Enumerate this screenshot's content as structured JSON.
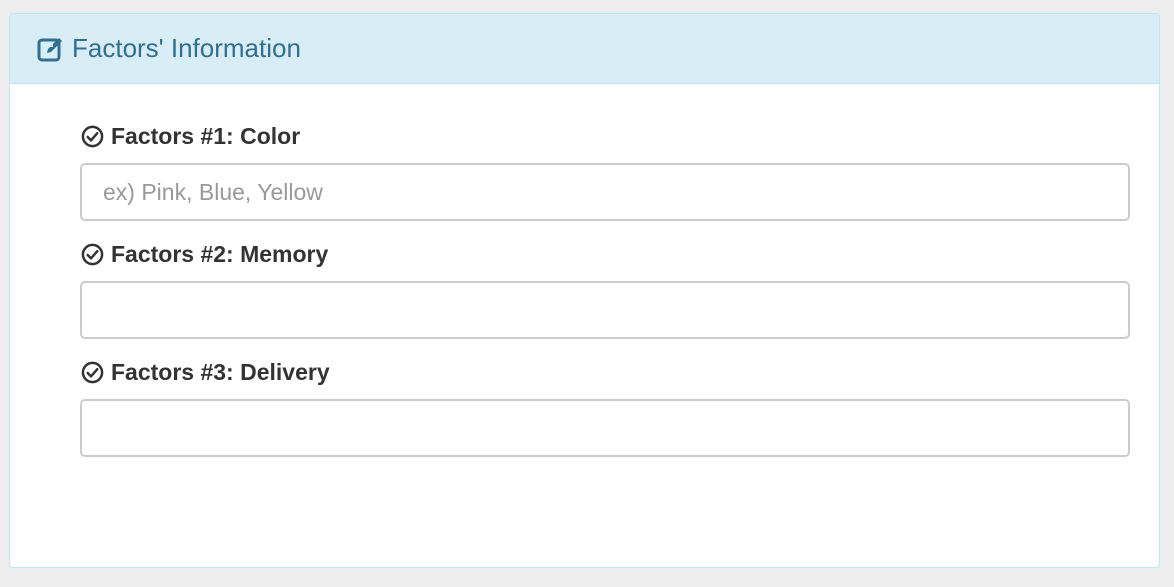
{
  "panel": {
    "title": "Factors' Information",
    "title_icon": "edit-icon",
    "accent_color": "#31708f",
    "heading_bg": "#d9edf7"
  },
  "factors": [
    {
      "label": "Factors #1: Color",
      "icon": "check-circle-icon",
      "value": "",
      "placeholder": "ex) Pink, Blue, Yellow"
    },
    {
      "label": "Factors #2: Memory",
      "icon": "check-circle-icon",
      "value": "",
      "placeholder": ""
    },
    {
      "label": "Factors #3: Delivery",
      "icon": "check-circle-icon",
      "value": "",
      "placeholder": ""
    }
  ]
}
